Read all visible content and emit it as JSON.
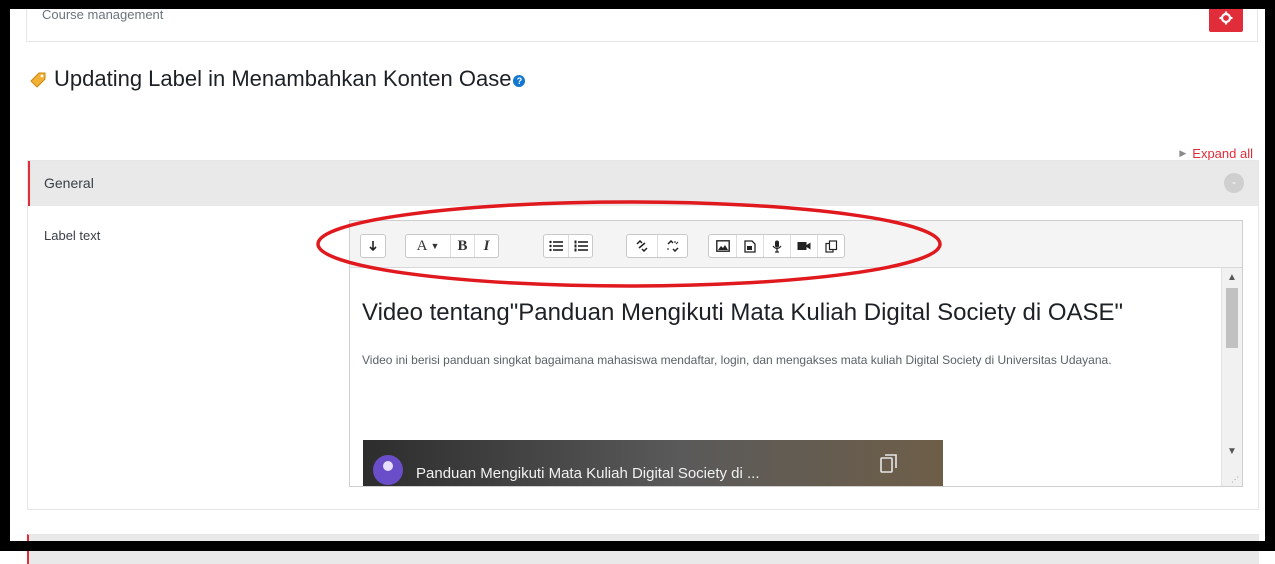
{
  "course_management": {
    "label": "Course management"
  },
  "page": {
    "title": "Updating Label in Menambahkan Konten Oase",
    "help": "?"
  },
  "expand_all": "Expand all",
  "section": {
    "title": "General",
    "collapse_symbol": "-"
  },
  "field": {
    "label": "Label text"
  },
  "toolbar": {
    "buttons": [
      {
        "name": "show-more-buttons",
        "icon": "expand-arrow-icon"
      },
      {
        "name": "font-size",
        "label": "A"
      },
      {
        "name": "bold",
        "label": "B"
      },
      {
        "name": "italic",
        "label": "I"
      },
      {
        "name": "unordered-list",
        "icon": "bullet-list-icon"
      },
      {
        "name": "ordered-list",
        "icon": "numbered-list-icon"
      },
      {
        "name": "link",
        "icon": "link-icon"
      },
      {
        "name": "unlink",
        "icon": "unlink-icon"
      },
      {
        "name": "insert-image",
        "icon": "image-icon"
      },
      {
        "name": "insert-media",
        "icon": "media-icon"
      },
      {
        "name": "record-audio",
        "icon": "microphone-icon"
      },
      {
        "name": "record-video",
        "icon": "video-camera-icon"
      },
      {
        "name": "manage-files",
        "icon": "files-icon"
      }
    ]
  },
  "content": {
    "heading": "Video tentang\"Panduan Mengikuti Mata Kuliah Digital Society di OASE\"",
    "paragraph": "Video ini berisi panduan singkat bagaimana mahasiswa mendaftar, login, dan mengakses mata kuliah Digital Society di Universitas Udayana.",
    "video_title": "Panduan Mengikuti Mata Kuliah Digital Society di ..."
  },
  "colors": {
    "accent": "#e12c3a",
    "help": "#1177d1",
    "annotation": "#e0191f"
  }
}
